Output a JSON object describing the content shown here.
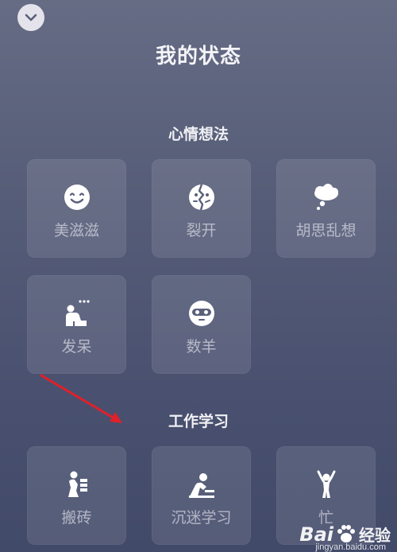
{
  "header": {
    "title": "我的状态",
    "collapse_icon": "chevron-down-icon"
  },
  "sections": [
    {
      "title": "心情想法",
      "items": [
        {
          "label": "美滋滋",
          "icon": "smile-face-icon"
        },
        {
          "label": "裂开",
          "icon": "cracked-face-icon"
        },
        {
          "label": "胡思乱想",
          "icon": "thought-cloud-icon"
        },
        {
          "label": "发呆",
          "icon": "daze-person-icon"
        },
        {
          "label": "数羊",
          "icon": "sleep-mask-face-icon"
        }
      ]
    },
    {
      "title": "工作学习",
      "items": [
        {
          "label": "搬砖",
          "icon": "carry-bricks-icon"
        },
        {
          "label": "沉迷学习",
          "icon": "study-person-icon"
        },
        {
          "label": "忙",
          "icon": "busy-person-icon"
        }
      ]
    }
  ],
  "watermark": {
    "brand": "Bai",
    "word": "经验",
    "url": "jingyan.baidu.com"
  },
  "colors": {
    "accent_arrow": "#e0202a",
    "tile_bg": "rgba(255,255,255,0.10)"
  }
}
